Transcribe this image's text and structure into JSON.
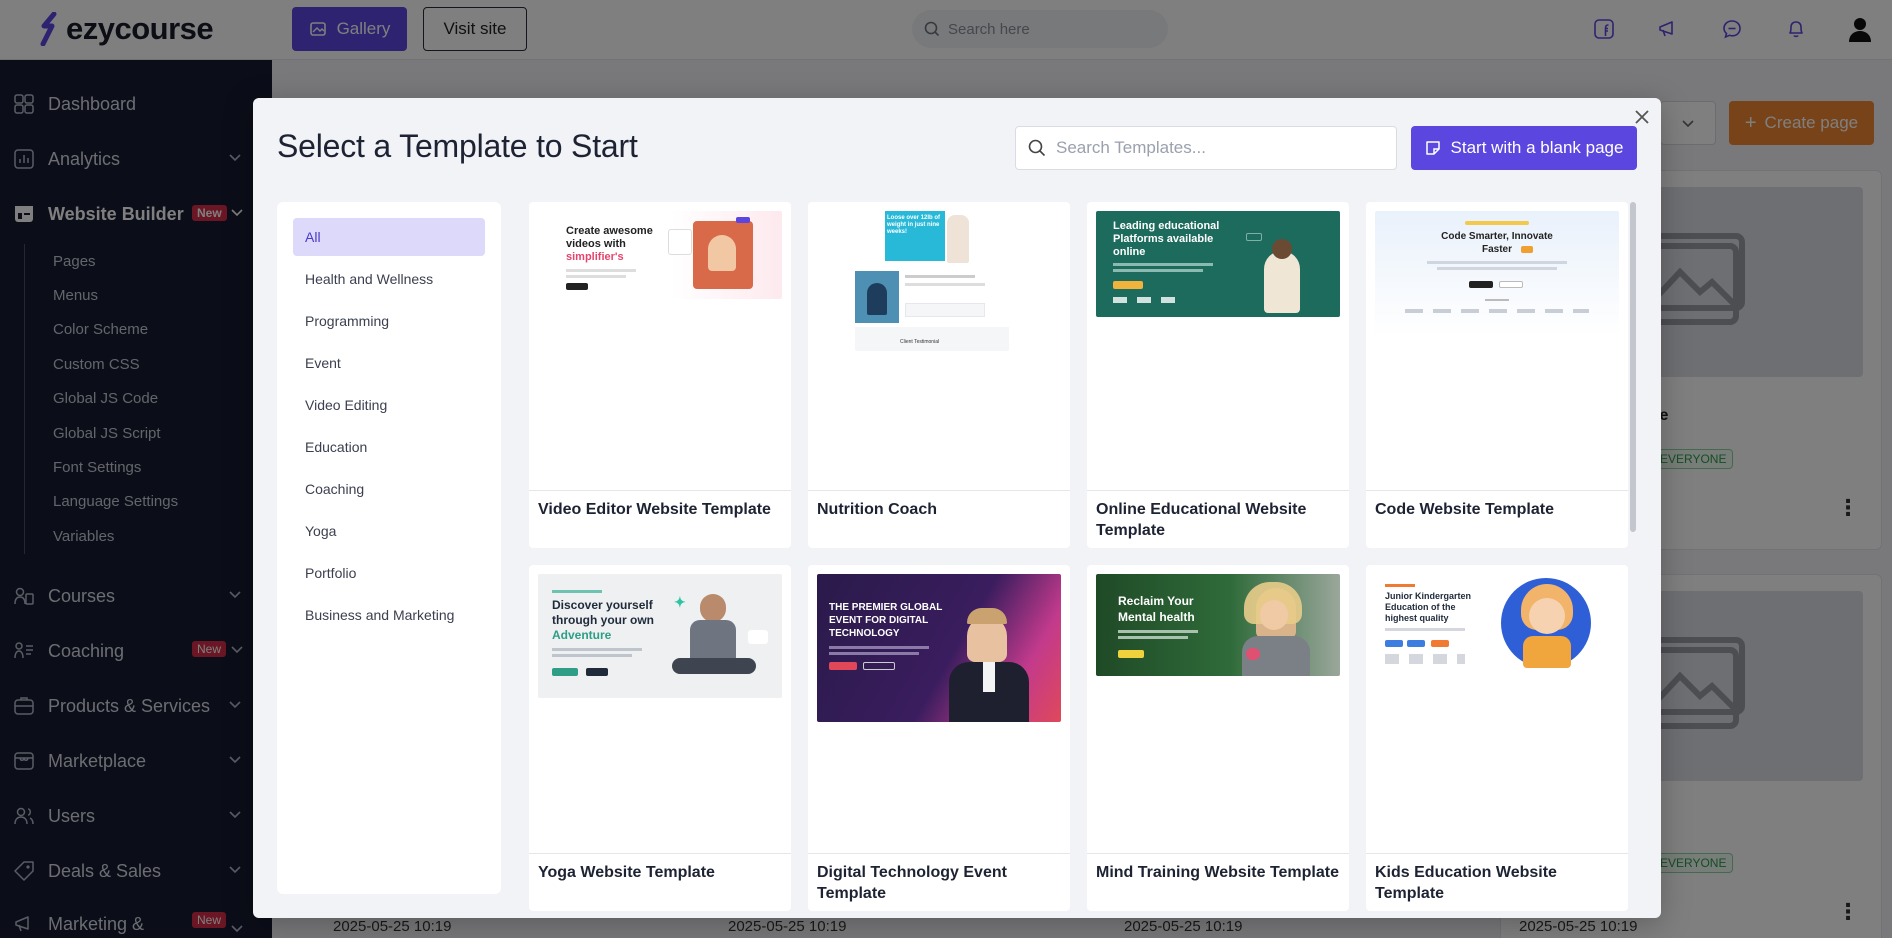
{
  "app": {
    "logo_text": "ezycourse",
    "gallery_label": "Gallery",
    "visit_site_label": "Visit site",
    "search_placeholder": "Search here"
  },
  "sidebar": {
    "items": [
      {
        "label": "Dashboard",
        "icon": "dashboard-icon"
      },
      {
        "label": "Analytics",
        "icon": "analytics-icon"
      },
      {
        "label": "Website Builder",
        "icon": "website-builder-icon",
        "badge": "New"
      },
      {
        "label": "Courses",
        "icon": "courses-icon"
      },
      {
        "label": "Coaching",
        "icon": "coaching-icon",
        "badge": "New"
      },
      {
        "label": "Products & Services",
        "icon": "products-icon"
      },
      {
        "label": "Marketplace",
        "icon": "marketplace-icon"
      },
      {
        "label": "Users",
        "icon": "users-icon"
      },
      {
        "label": "Deals & Sales",
        "icon": "deals-icon"
      },
      {
        "label": "Marketing &",
        "icon": "marketing-icon",
        "badge": "New"
      }
    ],
    "sub_items": [
      "Pages",
      "Menus",
      "Color Scheme",
      "Custom CSS",
      "Global JS Code",
      "Global JS Script",
      "Font Settings",
      "Language Settings",
      "Variables"
    ]
  },
  "background": {
    "create_page_label": "Create page",
    "card_title_fragment": "page",
    "visibility_badge": "EVERYONE",
    "dates": [
      "2025-05-25 10:19",
      "2025-05-25 10:19",
      "2025-05-25 10:19",
      "2025-05-25 10:19"
    ]
  },
  "modal": {
    "title": "Select a Template to Start",
    "search_placeholder": "Search Templates...",
    "blank_page_label": "Start with a blank page",
    "categories": [
      "All",
      "Health and Wellness",
      "Programming",
      "Event",
      "Video Editing",
      "Education",
      "Coaching",
      "Yoga",
      "Portfolio",
      "Business and Marketing"
    ],
    "active_category": "All",
    "templates": [
      {
        "name": "Video Editor Website Template",
        "thumb": {
          "line1": "Create awesome",
          "line2": "videos with",
          "line3": "simplifier's"
        }
      },
      {
        "name": "Nutrition Coach",
        "thumb": {
          "line1": "Loose over 12lb of",
          "line2": "weight in just nine",
          "line3": "weeks!",
          "footer": "Client Testimonial"
        }
      },
      {
        "name": "Online Educational Website Template",
        "thumb": {
          "line1": "Leading educational",
          "line2": "Platforms available",
          "line3": "online"
        }
      },
      {
        "name": "Code Website Template",
        "thumb": {
          "line1": "Code Smarter, Innovate",
          "line2": "Faster"
        }
      },
      {
        "name": "Yoga Website Template",
        "thumb": {
          "line1": "Discover yourself",
          "line2": "through your own",
          "line3": "Adventure"
        }
      },
      {
        "name": "Digital Technology Event Template",
        "thumb": {
          "line1": "THE PREMIER GLOBAL",
          "line2": "EVENT FOR DIGITAL",
          "line3": "TECHNOLOGY"
        }
      },
      {
        "name": "Mind Training Website Template",
        "thumb": {
          "line1": "Reclaim Your",
          "line2": "Mental health"
        }
      },
      {
        "name": "Kids Education Website Template",
        "thumb": {
          "line1": "Junior Kindergarten",
          "line2": "Education of the",
          "line3": "highest quality"
        }
      }
    ]
  },
  "colors": {
    "accent": "#5b46e0",
    "sidebar_bg": "#171b31",
    "badge_red": "#d62d48",
    "create_orange": "#f08632"
  }
}
